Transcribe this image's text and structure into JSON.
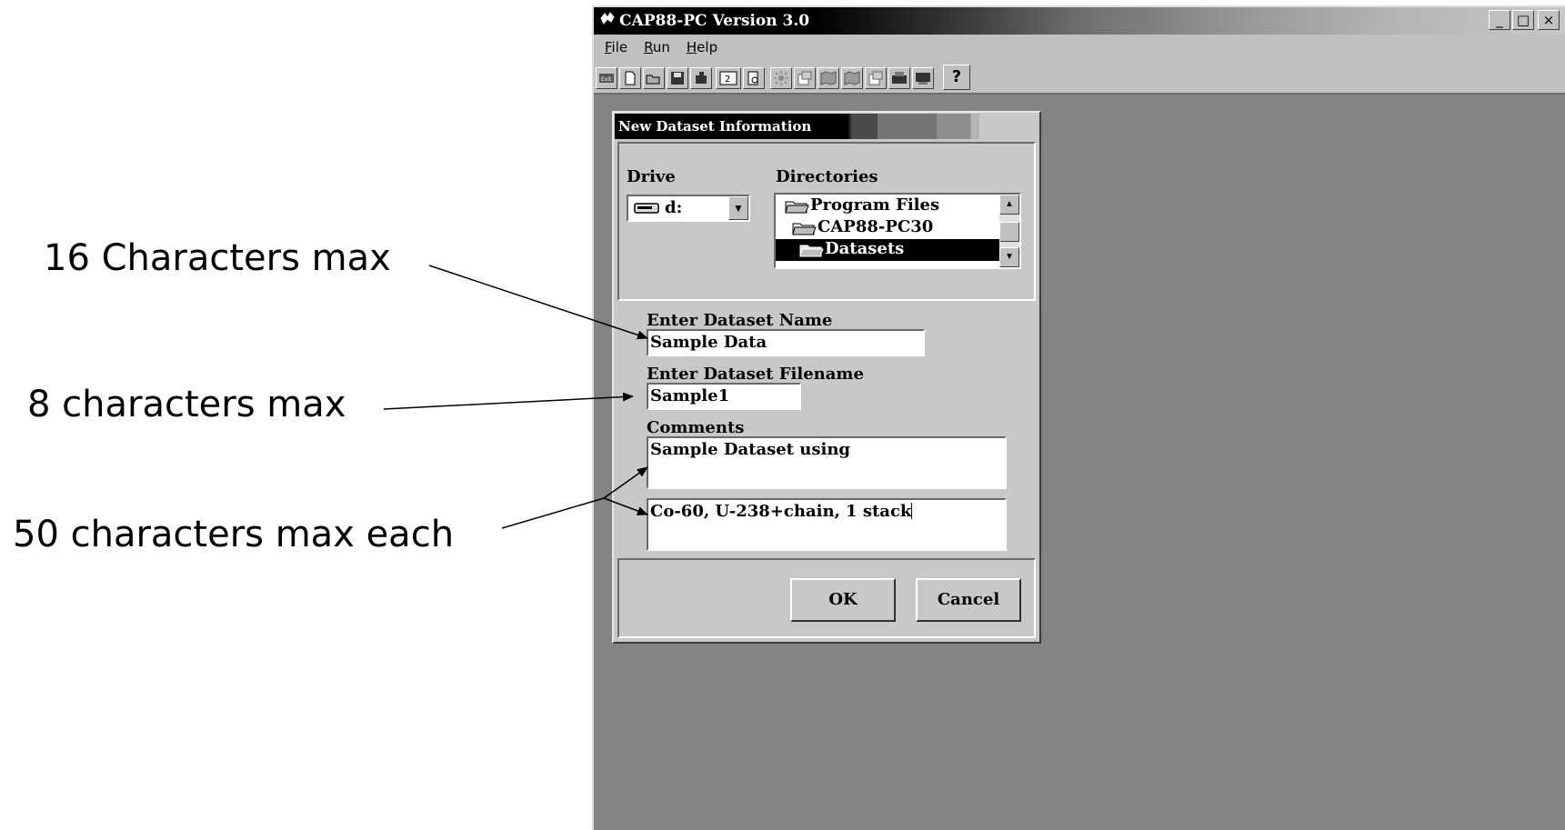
{
  "annotations": {
    "name_limit": "16 Characters max",
    "filename_limit": "8 characters max",
    "comments_limit": "50 characters max each"
  },
  "window": {
    "title": "CAP88-PC Version 3.0",
    "controls": {
      "minimize": "_",
      "maximize": "□",
      "close": "×"
    }
  },
  "menu": [
    "File",
    "Run",
    "Help"
  ],
  "toolbar": {
    "icons": [
      "exit-icon",
      "new-file-icon",
      "open-folder-icon",
      "save-icon",
      "close-file-icon",
      "report-icon",
      "preview-icon",
      "sun-icon",
      "dataset-icon",
      "map-icon",
      "map-icon",
      "chart-icon",
      "print-icon",
      "print-preview-icon"
    ],
    "help_label": "?"
  },
  "dialog": {
    "title": "New Dataset Information",
    "drive_label": "Drive",
    "drive_value": "d:",
    "directories_label": "Directories",
    "directories": [
      "Program Files",
      "CAP88-PC30",
      "Datasets"
    ],
    "selected_directory": "Datasets",
    "name_label": "Enter Dataset Name",
    "name_value": "Sample Data",
    "filename_label": "Enter Dataset Filename",
    "filename_value": "Sample1",
    "comments_label": "Comments",
    "comment1": "Sample Dataset using",
    "comment2": "Co-60, U-238+chain, 1 stack",
    "ok_label": "OK",
    "cancel_label": "Cancel"
  }
}
